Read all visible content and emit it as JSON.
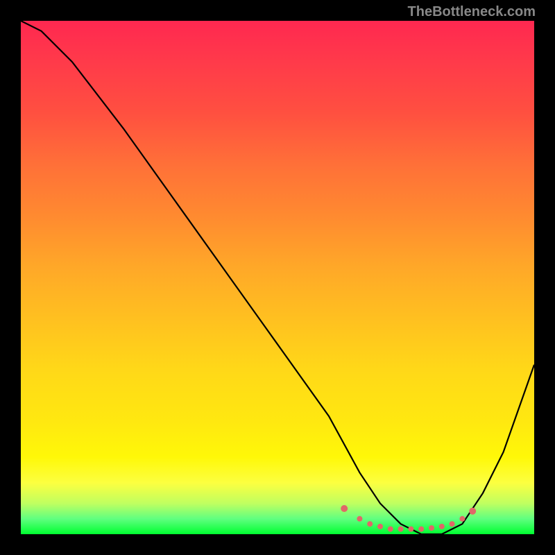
{
  "watermark": "TheBottleneck.com",
  "chart_data": {
    "type": "line",
    "title": "",
    "xlabel": "",
    "ylabel": "",
    "xlim": [
      0,
      100
    ],
    "ylim": [
      0,
      100
    ],
    "series": [
      {
        "name": "curve",
        "x": [
          0,
          4,
          10,
          20,
          30,
          40,
          50,
          60,
          66,
          70,
          74,
          78,
          82,
          86,
          90,
          94,
          100
        ],
        "values": [
          100,
          98,
          92,
          79,
          65,
          51,
          37,
          23,
          12,
          6,
          2,
          0,
          0,
          2,
          8,
          16,
          33
        ]
      }
    ],
    "markers": {
      "name": "bottom-markers",
      "color": "#e06868",
      "x": [
        63,
        66,
        68,
        70,
        72,
        74,
        76,
        78,
        80,
        82,
        84,
        86,
        88
      ],
      "values": [
        5,
        3,
        2,
        1.5,
        1,
        1,
        1,
        1,
        1.2,
        1.5,
        2,
        3,
        4.5
      ]
    }
  }
}
